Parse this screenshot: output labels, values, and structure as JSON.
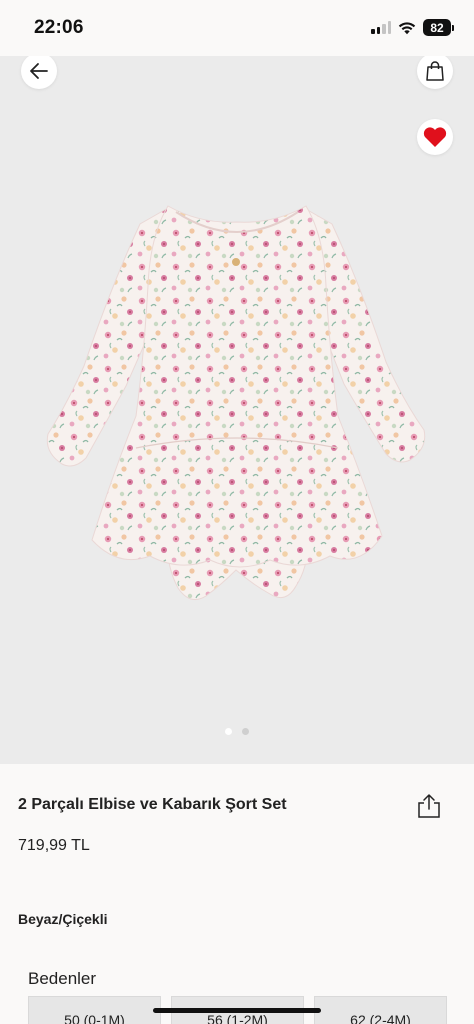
{
  "status_bar": {
    "time": "22:06",
    "battery_level": "82",
    "icons": [
      "signal-icon",
      "wifi-icon",
      "battery-icon"
    ]
  },
  "header": {
    "icons": [
      "back-arrow-icon",
      "shopping-bag-icon",
      "heart-icon"
    ],
    "favorite_active": true,
    "favorite_color": "#e0101c"
  },
  "gallery": {
    "image_count": 2,
    "active_index": 0,
    "background_color": "#ebebeb"
  },
  "product": {
    "title": "2 Parçalı Elbise ve Kabarık Şort Set",
    "price": "719,99 TL",
    "color": "Beyaz/Çiçekli"
  },
  "sizes": {
    "heading": "Bedenler",
    "options": [
      "50 (0-1M)",
      "56 (1-2M)",
      "62 (2-4M)"
    ]
  }
}
